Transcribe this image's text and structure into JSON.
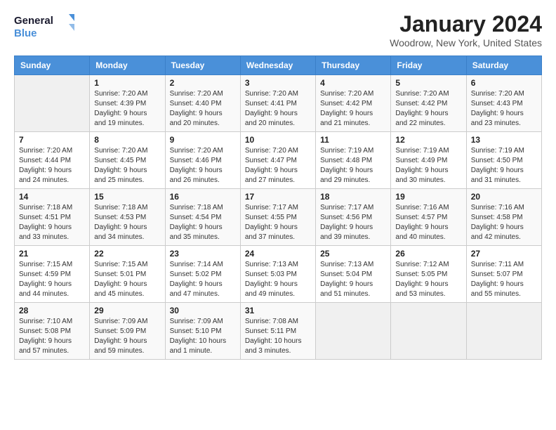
{
  "header": {
    "logo_line1": "General",
    "logo_line2": "Blue",
    "title": "January 2024",
    "subtitle": "Woodrow, New York, United States"
  },
  "weekdays": [
    "Sunday",
    "Monday",
    "Tuesday",
    "Wednesday",
    "Thursday",
    "Friday",
    "Saturday"
  ],
  "weeks": [
    [
      {
        "day": "",
        "info": ""
      },
      {
        "day": "1",
        "info": "Sunrise: 7:20 AM\nSunset: 4:39 PM\nDaylight: 9 hours\nand 19 minutes."
      },
      {
        "day": "2",
        "info": "Sunrise: 7:20 AM\nSunset: 4:40 PM\nDaylight: 9 hours\nand 20 minutes."
      },
      {
        "day": "3",
        "info": "Sunrise: 7:20 AM\nSunset: 4:41 PM\nDaylight: 9 hours\nand 20 minutes."
      },
      {
        "day": "4",
        "info": "Sunrise: 7:20 AM\nSunset: 4:42 PM\nDaylight: 9 hours\nand 21 minutes."
      },
      {
        "day": "5",
        "info": "Sunrise: 7:20 AM\nSunset: 4:42 PM\nDaylight: 9 hours\nand 22 minutes."
      },
      {
        "day": "6",
        "info": "Sunrise: 7:20 AM\nSunset: 4:43 PM\nDaylight: 9 hours\nand 23 minutes."
      }
    ],
    [
      {
        "day": "7",
        "info": "Sunrise: 7:20 AM\nSunset: 4:44 PM\nDaylight: 9 hours\nand 24 minutes."
      },
      {
        "day": "8",
        "info": "Sunrise: 7:20 AM\nSunset: 4:45 PM\nDaylight: 9 hours\nand 25 minutes."
      },
      {
        "day": "9",
        "info": "Sunrise: 7:20 AM\nSunset: 4:46 PM\nDaylight: 9 hours\nand 26 minutes."
      },
      {
        "day": "10",
        "info": "Sunrise: 7:20 AM\nSunset: 4:47 PM\nDaylight: 9 hours\nand 27 minutes."
      },
      {
        "day": "11",
        "info": "Sunrise: 7:19 AM\nSunset: 4:48 PM\nDaylight: 9 hours\nand 29 minutes."
      },
      {
        "day": "12",
        "info": "Sunrise: 7:19 AM\nSunset: 4:49 PM\nDaylight: 9 hours\nand 30 minutes."
      },
      {
        "day": "13",
        "info": "Sunrise: 7:19 AM\nSunset: 4:50 PM\nDaylight: 9 hours\nand 31 minutes."
      }
    ],
    [
      {
        "day": "14",
        "info": "Sunrise: 7:18 AM\nSunset: 4:51 PM\nDaylight: 9 hours\nand 33 minutes."
      },
      {
        "day": "15",
        "info": "Sunrise: 7:18 AM\nSunset: 4:53 PM\nDaylight: 9 hours\nand 34 minutes."
      },
      {
        "day": "16",
        "info": "Sunrise: 7:18 AM\nSunset: 4:54 PM\nDaylight: 9 hours\nand 35 minutes."
      },
      {
        "day": "17",
        "info": "Sunrise: 7:17 AM\nSunset: 4:55 PM\nDaylight: 9 hours\nand 37 minutes."
      },
      {
        "day": "18",
        "info": "Sunrise: 7:17 AM\nSunset: 4:56 PM\nDaylight: 9 hours\nand 39 minutes."
      },
      {
        "day": "19",
        "info": "Sunrise: 7:16 AM\nSunset: 4:57 PM\nDaylight: 9 hours\nand 40 minutes."
      },
      {
        "day": "20",
        "info": "Sunrise: 7:16 AM\nSunset: 4:58 PM\nDaylight: 9 hours\nand 42 minutes."
      }
    ],
    [
      {
        "day": "21",
        "info": "Sunrise: 7:15 AM\nSunset: 4:59 PM\nDaylight: 9 hours\nand 44 minutes."
      },
      {
        "day": "22",
        "info": "Sunrise: 7:15 AM\nSunset: 5:01 PM\nDaylight: 9 hours\nand 45 minutes."
      },
      {
        "day": "23",
        "info": "Sunrise: 7:14 AM\nSunset: 5:02 PM\nDaylight: 9 hours\nand 47 minutes."
      },
      {
        "day": "24",
        "info": "Sunrise: 7:13 AM\nSunset: 5:03 PM\nDaylight: 9 hours\nand 49 minutes."
      },
      {
        "day": "25",
        "info": "Sunrise: 7:13 AM\nSunset: 5:04 PM\nDaylight: 9 hours\nand 51 minutes."
      },
      {
        "day": "26",
        "info": "Sunrise: 7:12 AM\nSunset: 5:05 PM\nDaylight: 9 hours\nand 53 minutes."
      },
      {
        "day": "27",
        "info": "Sunrise: 7:11 AM\nSunset: 5:07 PM\nDaylight: 9 hours\nand 55 minutes."
      }
    ],
    [
      {
        "day": "28",
        "info": "Sunrise: 7:10 AM\nSunset: 5:08 PM\nDaylight: 9 hours\nand 57 minutes."
      },
      {
        "day": "29",
        "info": "Sunrise: 7:09 AM\nSunset: 5:09 PM\nDaylight: 9 hours\nand 59 minutes."
      },
      {
        "day": "30",
        "info": "Sunrise: 7:09 AM\nSunset: 5:10 PM\nDaylight: 10 hours\nand 1 minute."
      },
      {
        "day": "31",
        "info": "Sunrise: 7:08 AM\nSunset: 5:11 PM\nDaylight: 10 hours\nand 3 minutes."
      },
      {
        "day": "",
        "info": ""
      },
      {
        "day": "",
        "info": ""
      },
      {
        "day": "",
        "info": ""
      }
    ]
  ]
}
